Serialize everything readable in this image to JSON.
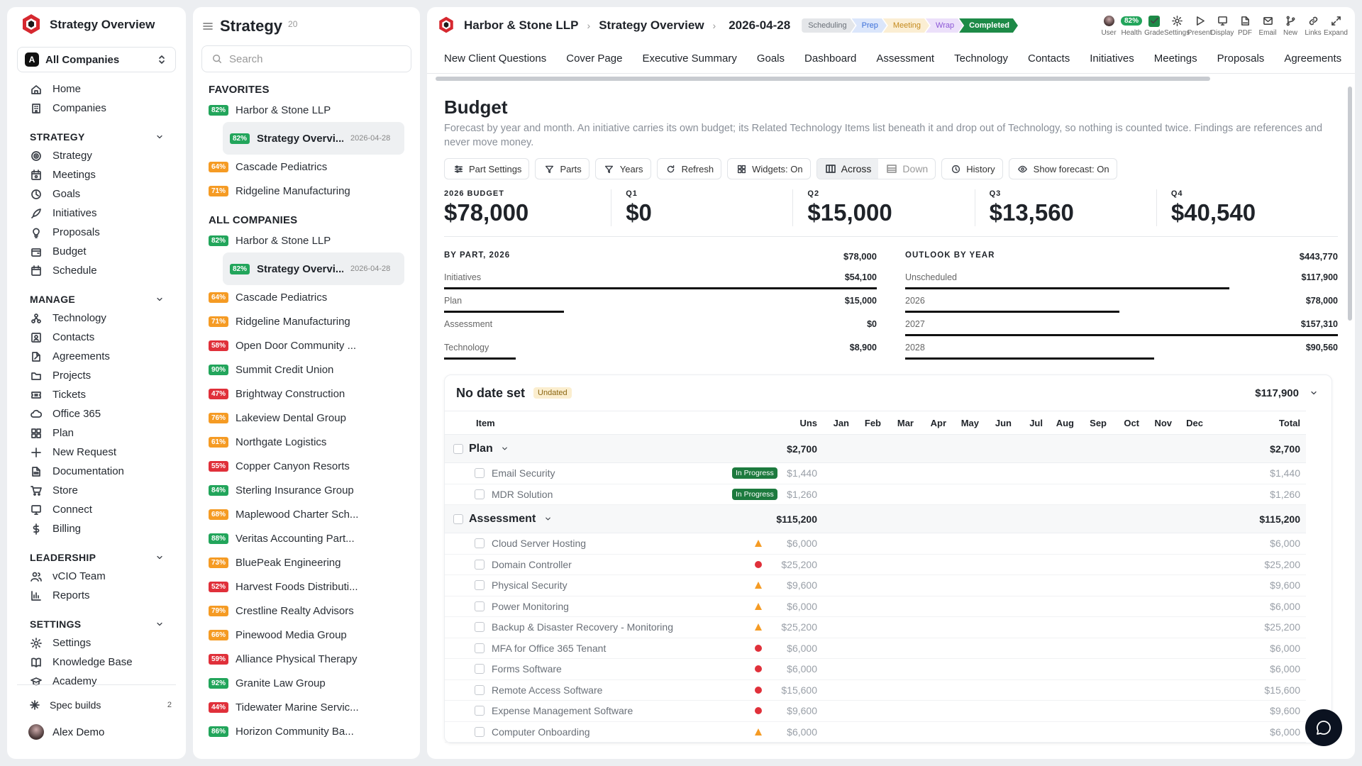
{
  "sidebar": {
    "title": "Strategy Overview",
    "company_select": {
      "badge": "A",
      "label": "All Companies"
    },
    "top": [
      {
        "label": "Home",
        "icon": "home-icon"
      },
      {
        "label": "Companies",
        "icon": "building-icon"
      }
    ],
    "sections": [
      {
        "title": "STRATEGY",
        "items": [
          {
            "label": "Strategy",
            "icon": "target-icon"
          },
          {
            "label": "Meetings",
            "icon": "calendar-users-icon"
          },
          {
            "label": "Goals",
            "icon": "goal-icon"
          },
          {
            "label": "Initiatives",
            "icon": "rocket-icon"
          },
          {
            "label": "Proposals",
            "icon": "lightbulb-icon"
          },
          {
            "label": "Budget",
            "icon": "wallet-icon"
          },
          {
            "label": "Schedule",
            "icon": "calendar-icon"
          }
        ]
      },
      {
        "title": "MANAGE",
        "items": [
          {
            "label": "Technology",
            "icon": "network-icon"
          },
          {
            "label": "Contacts",
            "icon": "contact-icon"
          },
          {
            "label": "Agreements",
            "icon": "file-edit-icon"
          },
          {
            "label": "Projects",
            "icon": "folder-icon"
          },
          {
            "label": "Tickets",
            "icon": "ticket-icon"
          },
          {
            "label": "Office 365",
            "icon": "cloud-icon"
          },
          {
            "label": "Plan",
            "icon": "grid-icon"
          },
          {
            "label": "New Request",
            "icon": "plus-icon"
          },
          {
            "label": "Documentation",
            "icon": "document-icon"
          },
          {
            "label": "Store",
            "icon": "cart-icon"
          },
          {
            "label": "Connect",
            "icon": "monitor-icon"
          },
          {
            "label": "Billing",
            "icon": "dollar-icon"
          }
        ]
      },
      {
        "title": "LEADERSHIP",
        "items": [
          {
            "label": "vCIO Team",
            "icon": "users-icon"
          },
          {
            "label": "Reports",
            "icon": "bar-chart-icon"
          }
        ]
      },
      {
        "title": "SETTINGS",
        "items": [
          {
            "label": "Settings",
            "icon": "gear-icon"
          },
          {
            "label": "Knowledge Base",
            "icon": "book-icon"
          },
          {
            "label": "Academy",
            "icon": "graduation-cap-icon"
          }
        ]
      }
    ],
    "footer": {
      "spec_builds": "Spec builds",
      "spec_count": "2",
      "user": "Alex Demo"
    }
  },
  "list": {
    "title": "Strategy",
    "count": "20",
    "search_placeholder": "Search",
    "favorites_label": "FAVORITES",
    "all_label": "ALL COMPANIES",
    "sub": {
      "badge": "82%",
      "name": "Strategy Overvi...",
      "date": "2026-04-28"
    },
    "favorites": [
      {
        "badge": "82%",
        "color": "#22a55b",
        "name": "Harbor & Stone LLP"
      },
      {
        "badge": "64%",
        "color": "#f59b24",
        "name": "Cascade Pediatrics"
      },
      {
        "badge": "71%",
        "color": "#f59b24",
        "name": "Ridgeline Manufacturing"
      }
    ],
    "companies": [
      {
        "badge": "82%",
        "color": "#22a55b",
        "name": "Harbor & Stone LLP"
      },
      {
        "badge": "64%",
        "color": "#f59b24",
        "name": "Cascade Pediatrics"
      },
      {
        "badge": "71%",
        "color": "#f59b24",
        "name": "Ridgeline Manufacturing"
      },
      {
        "badge": "58%",
        "color": "#e0303a",
        "name": "Open Door Community ..."
      },
      {
        "badge": "90%",
        "color": "#22a55b",
        "name": "Summit Credit Union"
      },
      {
        "badge": "47%",
        "color": "#e0303a",
        "name": "Brightway Construction"
      },
      {
        "badge": "76%",
        "color": "#f59b24",
        "name": "Lakeview Dental Group"
      },
      {
        "badge": "61%",
        "color": "#f59b24",
        "name": "Northgate Logistics"
      },
      {
        "badge": "55%",
        "color": "#e0303a",
        "name": "Copper Canyon Resorts"
      },
      {
        "badge": "84%",
        "color": "#22a55b",
        "name": "Sterling Insurance Group"
      },
      {
        "badge": "68%",
        "color": "#f59b24",
        "name": "Maplewood Charter Sch..."
      },
      {
        "badge": "88%",
        "color": "#22a55b",
        "name": "Veritas Accounting Part..."
      },
      {
        "badge": "73%",
        "color": "#f59b24",
        "name": "BluePeak Engineering"
      },
      {
        "badge": "52%",
        "color": "#e0303a",
        "name": "Harvest Foods Distributi..."
      },
      {
        "badge": "79%",
        "color": "#f59b24",
        "name": "Crestline Realty Advisors"
      },
      {
        "badge": "66%",
        "color": "#f59b24",
        "name": "Pinewood Media Group"
      },
      {
        "badge": "59%",
        "color": "#e0303a",
        "name": "Alliance Physical Therapy"
      },
      {
        "badge": "92%",
        "color": "#22a55b",
        "name": "Granite Law Group"
      },
      {
        "badge": "44%",
        "color": "#e0303a",
        "name": "Tidewater Marine Servic..."
      },
      {
        "badge": "86%",
        "color": "#22a55b",
        "name": "Horizon Community Ba..."
      }
    ]
  },
  "header": {
    "company": "Harbor & Stone LLP",
    "page": "Strategy Overview",
    "date": "2026-04-28",
    "stages": [
      {
        "label": "Scheduling",
        "bg": "#e4e6e9",
        "fg": "#6a7078"
      },
      {
        "label": "Prep",
        "bg": "#dbe6fb",
        "fg": "#3b6fd8"
      },
      {
        "label": "Meeting",
        "bg": "#fbeed3",
        "fg": "#c48a1e"
      },
      {
        "label": "Wrap",
        "bg": "#ece0fa",
        "fg": "#8b55d6"
      },
      {
        "label": "Completed",
        "bg": "#1d8a47",
        "fg": "#ffffff"
      }
    ],
    "health": "82%",
    "tools": [
      {
        "label": "User",
        "icon": "user-avatar-icon"
      },
      {
        "label": "Health",
        "icon": "health-badge-icon"
      },
      {
        "label": "Grade",
        "icon": "grade-check-icon"
      },
      {
        "label": "Settings",
        "icon": "gear-icon"
      },
      {
        "label": "Present",
        "icon": "play-icon"
      },
      {
        "label": "Display",
        "icon": "monitor-icon"
      },
      {
        "label": "PDF",
        "icon": "pdf-icon"
      },
      {
        "label": "Email",
        "icon": "mail-icon"
      },
      {
        "label": "New",
        "icon": "branch-icon"
      },
      {
        "label": "Links",
        "icon": "link-icon"
      },
      {
        "label": "Expand",
        "icon": "expand-icon"
      }
    ]
  },
  "tabs": [
    "New Client Questions",
    "Cover Page",
    "Executive Summary",
    "Goals",
    "Dashboard",
    "Assessment",
    "Technology",
    "Contacts",
    "Initiatives",
    "Meetings",
    "Proposals",
    "Agreements"
  ],
  "budget": {
    "title": "Budget",
    "description": "Forecast by year and month. An initiative carries its own budget; its Related Technology Items list beneath it and drop out of Technology, so nothing is counted twice. Findings are references and never move money.",
    "toolbar": {
      "part_settings": "Part Settings",
      "parts": "Parts",
      "years": "Years",
      "refresh": "Refresh",
      "widgets": "Widgets: On",
      "across": "Across",
      "down": "Down",
      "history": "History",
      "forecast": "Show forecast: On"
    },
    "kpis": [
      {
        "label": "2026 BUDGET",
        "value": "$78,000"
      },
      {
        "label": "Q1",
        "value": "$0"
      },
      {
        "label": "Q2",
        "value": "$15,000"
      },
      {
        "label": "Q3",
        "value": "$13,560"
      },
      {
        "label": "Q4",
        "value": "$40,540"
      }
    ],
    "by_part": {
      "title": "BY PART, 2026",
      "total": "$78,000",
      "rows": [
        {
          "name": "Initiatives",
          "amount": "$54,100",
          "fraction": 1.0
        },
        {
          "name": "Plan",
          "amount": "$15,000",
          "fraction": 0.277
        },
        {
          "name": "Assessment",
          "amount": "$0",
          "fraction": 0
        },
        {
          "name": "Technology",
          "amount": "$8,900",
          "fraction": 0.165
        }
      ]
    },
    "outlook": {
      "title": "OUTLOOK BY YEAR",
      "total": "$443,770",
      "rows": [
        {
          "name": "Unscheduled",
          "amount": "$117,900",
          "fraction": 0.749
        },
        {
          "name": "2026",
          "amount": "$78,000",
          "fraction": 0.495
        },
        {
          "name": "2027",
          "amount": "$157,310",
          "fraction": 1.0
        },
        {
          "name": "2028",
          "amount": "$90,560",
          "fraction": 0.576
        }
      ]
    },
    "table": {
      "title": "No date set",
      "tag": "Undated",
      "amount": "$117,900",
      "columns": [
        "Item",
        "Uns",
        "Jan",
        "Feb",
        "Mar",
        "Apr",
        "May",
        "Jun",
        "Jul",
        "Aug",
        "Sep",
        "Oct",
        "Nov",
        "Dec",
        "Total"
      ],
      "groups": [
        {
          "name": "Plan",
          "uns": "$2,700",
          "total": "$2,700",
          "items": [
            {
              "name": "Email Security",
              "status": "In Progress",
              "uns": "$1,440",
              "total": "$1,440"
            },
            {
              "name": "MDR Solution",
              "status": "In Progress",
              "uns": "$1,260",
              "total": "$1,260"
            }
          ]
        },
        {
          "name": "Assessment",
          "uns": "$115,200",
          "total": "$115,200",
          "items": [
            {
              "name": "Cloud Server Hosting",
              "status": "warning",
              "uns": "$6,000",
              "total": "$6,000"
            },
            {
              "name": "Domain Controller",
              "status": "critical",
              "uns": "$25,200",
              "total": "$25,200"
            },
            {
              "name": "Physical Security",
              "status": "warning",
              "uns": "$9,600",
              "total": "$9,600"
            },
            {
              "name": "Power Monitoring",
              "status": "warning",
              "uns": "$6,000",
              "total": "$6,000"
            },
            {
              "name": "Backup & Disaster Recovery - Monitoring",
              "status": "warning",
              "uns": "$25,200",
              "total": "$25,200"
            },
            {
              "name": "MFA for Office 365 Tenant",
              "status": "critical",
              "uns": "$6,000",
              "total": "$6,000"
            },
            {
              "name": "Forms Software",
              "status": "critical",
              "uns": "$6,000",
              "total": "$6,000"
            },
            {
              "name": "Remote Access Software",
              "status": "critical",
              "uns": "$15,600",
              "total": "$15,600"
            },
            {
              "name": "Expense Management Software",
              "status": "critical",
              "uns": "$9,600",
              "total": "$9,600"
            },
            {
              "name": "Computer Onboarding",
              "status": "warning",
              "uns": "$6,000",
              "total": "$6,000"
            }
          ]
        }
      ]
    }
  }
}
